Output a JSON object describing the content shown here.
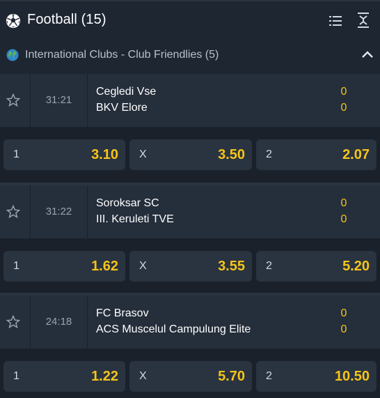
{
  "header": {
    "title": "Football (15)",
    "sport_icon": "football-icon",
    "list_icon": "list-view-icon",
    "collapse_icon": "collapse-all-icon"
  },
  "league": {
    "name": "International Clubs - Club Friendlies (5)",
    "icon": "globe-icon",
    "toggle_icon": "chevron-up-icon"
  },
  "matches": [
    {
      "time": "31:21",
      "home": "Cegledi Vse",
      "away": "BKV Elore",
      "home_score": "0",
      "away_score": "0",
      "odds": [
        {
          "label": "1",
          "value": "3.10"
        },
        {
          "label": "X",
          "value": "3.50"
        },
        {
          "label": "2",
          "value": "2.07"
        }
      ]
    },
    {
      "time": "31:22",
      "home": "Soroksar SC",
      "away": "III. Keruleti TVE",
      "home_score": "0",
      "away_score": "0",
      "odds": [
        {
          "label": "1",
          "value": "1.62"
        },
        {
          "label": "X",
          "value": "3.55"
        },
        {
          "label": "2",
          "value": "5.20"
        }
      ]
    },
    {
      "time": "24:18",
      "home": "FC Brasov",
      "away": "ACS Muscelul Campulung Elite",
      "home_score": "0",
      "away_score": "0",
      "odds": [
        {
          "label": "1",
          "value": "1.22"
        },
        {
          "label": "X",
          "value": "5.70"
        },
        {
          "label": "2",
          "value": "10.50"
        }
      ]
    }
  ],
  "colors": {
    "accent": "#f5c518",
    "background": "#1c2430",
    "card": "#252e3b",
    "odd_button": "#2a3340"
  }
}
